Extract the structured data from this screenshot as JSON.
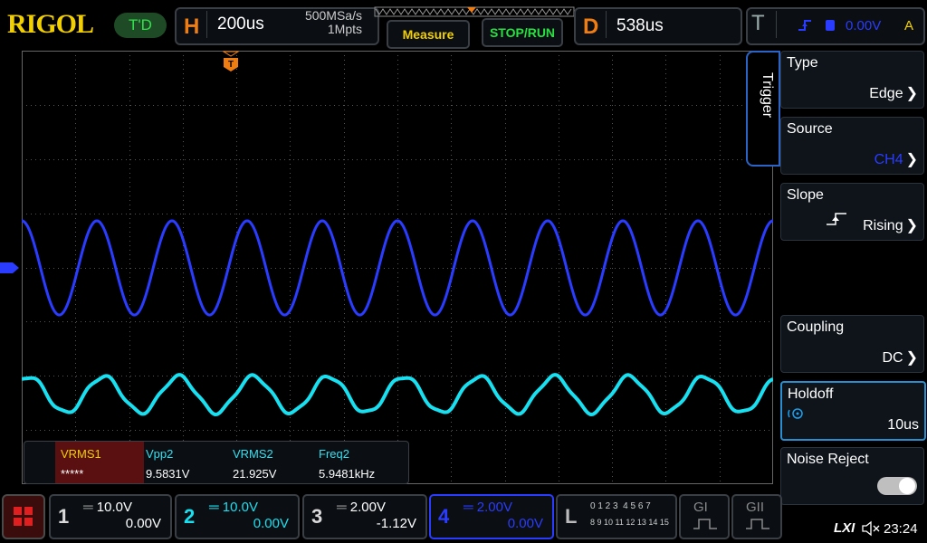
{
  "brand": {
    "logo": "RIGOL",
    "mode_badge": "T'D"
  },
  "horizontal": {
    "letter": "H",
    "timebase": "200us",
    "sample_rate": "500MSa/s",
    "memory": "1Mpts"
  },
  "buttons": {
    "measure": "Measure",
    "stop_run": "STOP/RUN"
  },
  "delay": {
    "letter": "D",
    "value": "538us"
  },
  "trigger_status": {
    "letter": "T",
    "level": "0.00V",
    "mode": "A"
  },
  "trigger_menu": {
    "tab": "Trigger",
    "items": [
      {
        "label": "Type",
        "value": "Edge"
      },
      {
        "label": "Source",
        "value": "CH4"
      },
      {
        "label": "Slope",
        "value": "Rising"
      },
      {
        "label": "Coupling",
        "value": "DC"
      },
      {
        "label": "Holdoff",
        "value": "10us"
      },
      {
        "label": "Noise Reject",
        "value": ""
      }
    ]
  },
  "measurements": [
    {
      "name": "VRMS1",
      "value": "*****"
    },
    {
      "name": "Vpp2",
      "value": "9.5831V"
    },
    {
      "name": "VRMS2",
      "value": "21.925V"
    },
    {
      "name": "Freq2",
      "value": "5.9481kHz"
    }
  ],
  "channels": [
    {
      "num": "1",
      "scale": "10.0V",
      "offset": "0.00V",
      "color": "#d9d9d9"
    },
    {
      "num": "2",
      "scale": "10.0V",
      "offset": "0.00V",
      "color": "#19e0f0"
    },
    {
      "num": "3",
      "scale": "2.00V",
      "offset": "-1.12V",
      "color": "#d9d9d9"
    },
    {
      "num": "4",
      "scale": "2.00V",
      "offset": "0.00V",
      "color": "#2a3cff"
    }
  ],
  "logic": {
    "letter": "L",
    "row1": "0 1 2 3  4 5 6 7",
    "row2": "8 9 10 11 12 13 14 15"
  },
  "generators": {
    "g1": "GI",
    "g2": "GII"
  },
  "status": {
    "lxi": "LXI",
    "time": "23:24"
  },
  "colors": {
    "ch4": "#2a3cff",
    "ch2": "#19e0f0",
    "accent": "#f07d12",
    "grid": "#5a5a5a"
  }
}
